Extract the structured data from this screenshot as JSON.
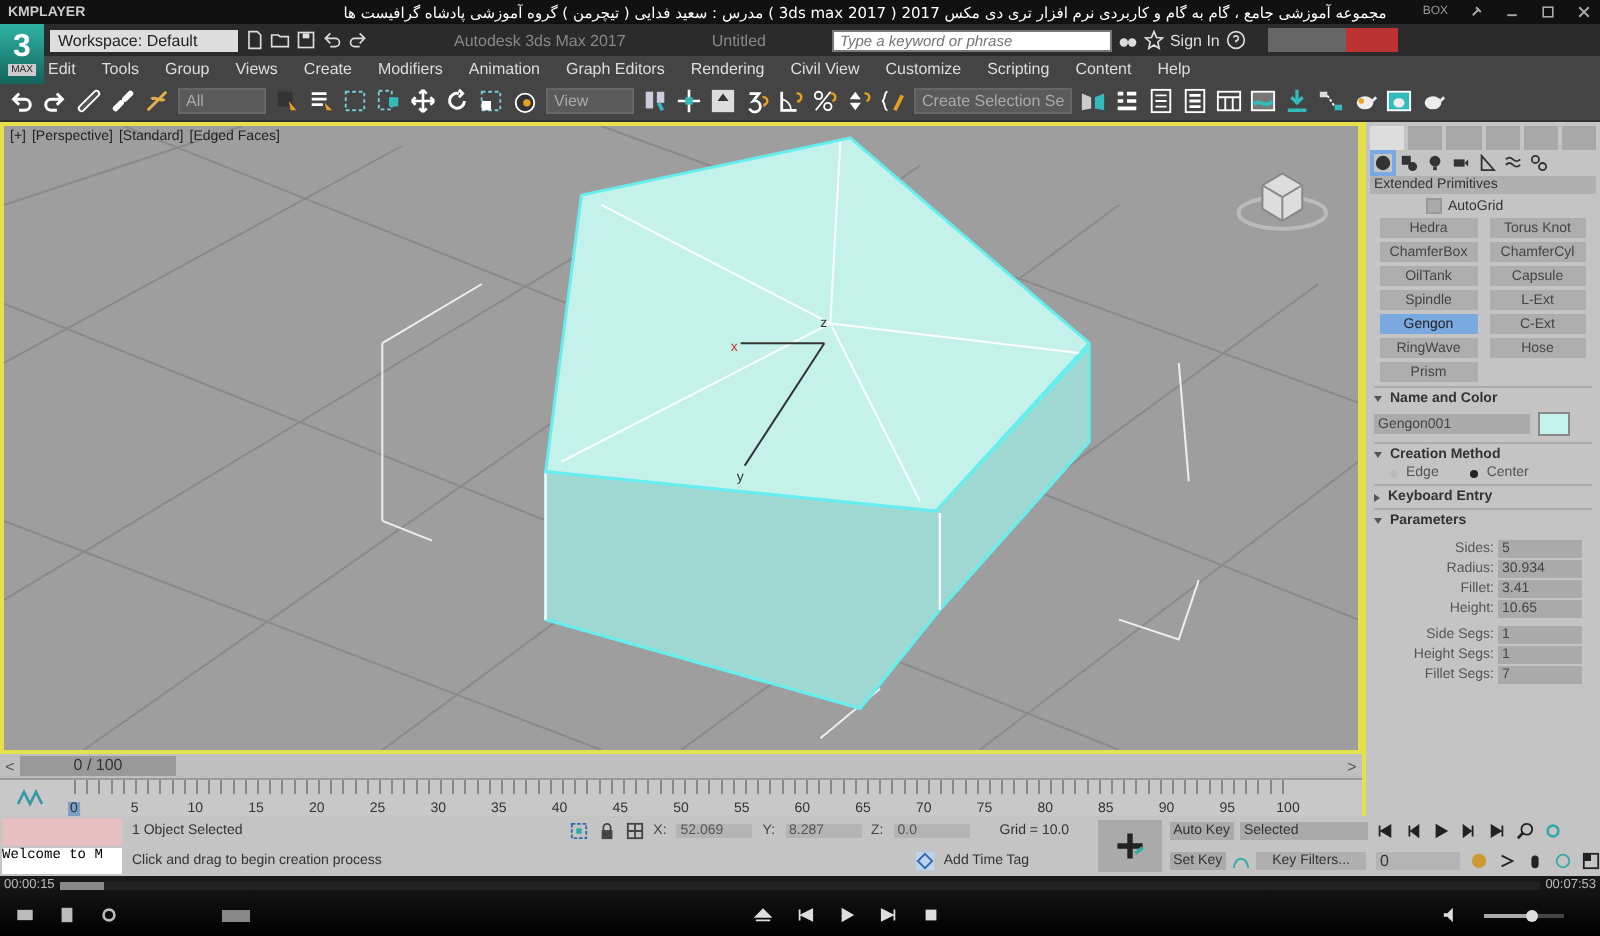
{
  "player": {
    "brand": "KMPLAYER",
    "title": "مجموعه آموزشی جامع ، گام به گام و کاربردی نرم افزار تری دی مکس 2017 ( 3ds max 2017 ) مدرس : سعید فدایی ( تیچرمن ) گروه آموزشی پادشاه گرافیست ها",
    "box_label": "BOX",
    "elapsed": "00:00:15",
    "total": "00:07:53",
    "progress": {
      "level": 0.03
    },
    "volume": {
      "level": 0.6
    }
  },
  "app": {
    "logo": "3",
    "logo_sub": "MAX",
    "workspace": "Workspace: Default",
    "title": "Autodesk 3ds Max 2017",
    "document": "Untitled",
    "search": {
      "placeholder": "Type a keyword or phrase"
    },
    "sign_in": "Sign In"
  },
  "menu": [
    "Edit",
    "Tools",
    "Group",
    "Views",
    "Create",
    "Modifiers",
    "Animation",
    "Graph Editors",
    "Rendering",
    "Civil View",
    "Customize",
    "Scripting",
    "Content",
    "Help"
  ],
  "toolbar": {
    "selection_filter": "All",
    "reference_coord": "View",
    "selection_set": "Create Selection Se"
  },
  "viewport": {
    "labels": [
      "[+]",
      "[Perspective]",
      "[Standard]",
      "[Edged Faces]"
    ],
    "axes": [
      "x",
      "y",
      "z"
    ]
  },
  "command_panel": {
    "category": "Extended Primitives",
    "autogrid": {
      "label": "AutoGrid",
      "checked": false
    },
    "object_buttons": [
      {
        "label": "Hedra",
        "selected": false
      },
      {
        "label": "Torus Knot",
        "selected": false
      },
      {
        "label": "ChamferBox",
        "selected": false
      },
      {
        "label": "ChamferCyl",
        "selected": false
      },
      {
        "label": "OilTank",
        "selected": false
      },
      {
        "label": "Capsule",
        "selected": false
      },
      {
        "label": "Spindle",
        "selected": false
      },
      {
        "label": "L-Ext",
        "selected": false
      },
      {
        "label": "Gengon",
        "selected": true
      },
      {
        "label": "C-Ext",
        "selected": false
      },
      {
        "label": "RingWave",
        "selected": false
      },
      {
        "label": "Hose",
        "selected": false
      },
      {
        "label": "Prism",
        "selected": false
      }
    ],
    "rollouts": [
      {
        "kind": "name",
        "title": "Name and Color",
        "expanded": true,
        "name": "Gengon001"
      },
      {
        "kind": "radio",
        "title": "Creation Method",
        "expanded": true,
        "options": [
          {
            "label": "Edge",
            "selected": false
          },
          {
            "label": "Center",
            "selected": true
          }
        ]
      },
      {
        "kind": "empty",
        "title": "Keyboard Entry",
        "expanded": false
      },
      {
        "kind": "params",
        "title": "Parameters",
        "expanded": true,
        "groups": [
          [
            {
              "label": "Sides:",
              "value": "5"
            },
            {
              "label": "Radius:",
              "value": "30.934"
            },
            {
              "label": "Fillet:",
              "value": "3.41"
            },
            {
              "label": "Height:",
              "value": "10.65"
            }
          ],
          [
            {
              "label": "Side Segs:",
              "value": "1"
            },
            {
              "label": "Height Segs:",
              "value": "1"
            },
            {
              "label": "Fillet Segs:",
              "value": "7"
            }
          ]
        ]
      }
    ]
  },
  "timeline": {
    "prev": "<",
    "next": ">",
    "slider": {
      "text": "0 / 100",
      "level": 0
    },
    "ticks": [
      "0",
      "5",
      "10",
      "15",
      "20",
      "25",
      "30",
      "35",
      "40",
      "45",
      "50",
      "55",
      "60",
      "65",
      "70",
      "75",
      "80",
      "85",
      "90",
      "95",
      "100"
    ]
  },
  "status": {
    "welcome": "Welcome to M",
    "selection": "1 Object Selected",
    "prompt": "Click and drag to begin creation process",
    "coords": [
      {
        "label": "X:",
        "value": "52.069"
      },
      {
        "label": "Y:",
        "value": "8.287"
      },
      {
        "label": "Z:",
        "value": "0.0"
      }
    ],
    "grid": "Grid = 10.0",
    "time_tag": "Add Time Tag",
    "auto_key": "Auto Key",
    "set_key": "Set Key",
    "key_mode": "Selected",
    "key_filters": "Key Filters...",
    "frame": "0"
  }
}
